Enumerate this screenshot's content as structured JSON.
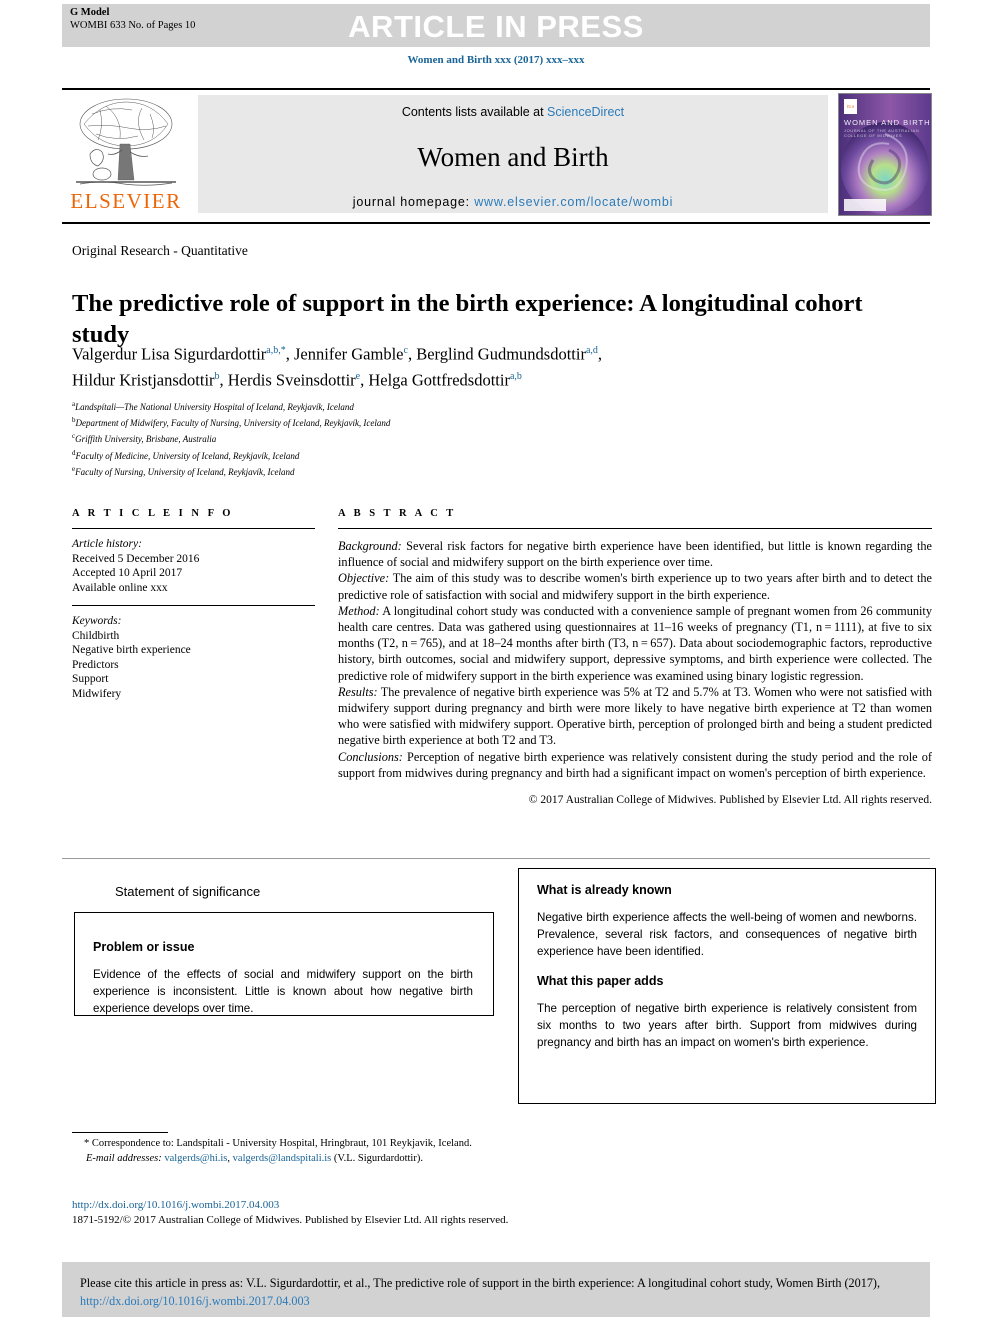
{
  "header": {
    "g_model_label": "G Model",
    "g_model_id": "WOMBI 633 No. of Pages 10",
    "article_in_press": "ARTICLE IN PRESS",
    "journal_citation": "Women and Birth xxx (2017) xxx–xxx"
  },
  "masthead": {
    "publisher": "ELSEVIER",
    "contents_prefix": "Contents lists available at ",
    "contents_link": "ScienceDirect",
    "journal_name": "Women and Birth",
    "homepage_prefix": "journal homepage: ",
    "homepage_link": "www.elsevier.com/locate/wombi",
    "cover_title": "WOMEN AND BIRTH",
    "cover_subtitle": "JOURNAL OF THE AUSTRALIAN COLLEGE OF MIDWIVES",
    "cover_logo_text": "ELS"
  },
  "article": {
    "section": "Original Research - Quantitative",
    "title": "The predictive role of support in the birth experience: A longitudinal cohort study",
    "authors_line1_a": "Valgerdur Lisa Sigurdardottir",
    "authors_line1_a_sup": "a,b,*",
    "authors_line1_b": ", Jennifer Gamble",
    "authors_line1_b_sup": "c",
    "authors_line1_c": ", Berglind Gudmundsdottir",
    "authors_line1_c_sup": "a,d",
    "authors_line1_end": ",",
    "authors_line2_a": "Hildur Kristjansdottir",
    "authors_line2_a_sup": "b",
    "authors_line2_b": ", Herdis Sveinsdottir",
    "authors_line2_b_sup": "e",
    "authors_line2_c": ", Helga Gottfredsdottir",
    "authors_line2_c_sup": "a,b",
    "affiliations": [
      {
        "mark": "a",
        "text": "Landspítali—The National University Hospital of Iceland, Reykjavík, Iceland"
      },
      {
        "mark": "b",
        "text": "Department of Midwifery, Faculty of Nursing, University of Iceland, Reykjavík, Iceland"
      },
      {
        "mark": "c",
        "text": "Griffith University, Brisbane, Australia"
      },
      {
        "mark": "d",
        "text": "Faculty of Medicine, University of Iceland, Reykjavík, Iceland"
      },
      {
        "mark": "e",
        "text": "Faculty of Nursing, University of Iceland, Reykjavík, Iceland"
      }
    ]
  },
  "article_info": {
    "heading": "A R T I C L E  I N F O",
    "history_label": "Article history:",
    "received": "Received 5 December 2016",
    "accepted": "Accepted 10 April 2017",
    "available": "Available online xxx",
    "keywords_label": "Keywords:",
    "keywords": [
      "Childbirth",
      "Negative birth experience",
      "Predictors",
      "Support",
      "Midwifery"
    ]
  },
  "abstract": {
    "heading": "A B S T R A C T",
    "background_label": "Background:",
    "background_text": " Several risk factors for negative birth experience have been identified, but little is known regarding the influence of social and midwifery support on the birth experience over time.",
    "objective_label": "Objective:",
    "objective_text": " The aim of this study was to describe women's birth experience up to two years after birth and to detect the predictive role of satisfaction with social and midwifery support in the birth experience.",
    "method_label": "Method:",
    "method_text": " A longitudinal cohort study was conducted with a convenience sample of pregnant women from 26 community health care centres. Data was gathered using questionnaires at 11–16 weeks of pregnancy (T1, n = 1111), at five to six months (T2, n = 765), and at 18–24 months after birth (T3, n = 657). Data about sociodemographic factors, reproductive history, birth outcomes, social and midwifery support, depressive symptoms, and birth experience were collected. The predictive role of midwifery support in the birth experience was examined using binary logistic regression.",
    "results_label": "Results:",
    "results_text": " The prevalence of negative birth experience was 5% at T2 and 5.7% at T3. Women who were not satisfied with midwifery support during pregnancy and birth were more likely to have negative birth experience at T2 than women who were satisfied with midwifery support. Operative birth, perception of prolonged birth and being a student predicted negative birth experience at both T2 and T3.",
    "conclusions_label": "Conclusions:",
    "conclusions_text": " Perception of negative birth experience was relatively consistent during the study period and the role of support from midwives during pregnancy and birth had a significant impact on women's perception of birth experience.",
    "copyright": "© 2017 Australian College of Midwives. Published by Elsevier Ltd. All rights reserved."
  },
  "significance": {
    "title": "Statement of significance",
    "problem_heading": "Problem or issue",
    "problem_text": "Evidence of the effects of social and midwifery support on the birth experience is inconsistent. Little is known about how negative birth experience develops over time.",
    "known_heading": "What is already known",
    "known_text": "Negative birth experience affects the well-being of women and newborns. Prevalence, several risk factors, and consequences of negative birth experience have been identified.",
    "adds_heading": "What this paper adds",
    "adds_text": "The perception of negative birth experience is relatively consistent from six months to two years after birth. Support from midwives during pregnancy and birth has an impact on women's birth experience."
  },
  "footnotes": {
    "correspondence_mark": "*",
    "correspondence_text": " Correspondence to: Landspitali - University Hospital, Hringbraut, 101 Reykjavik, Iceland.",
    "email_label": "E-mail addresses:",
    "email_1": "valgerds@hi.is",
    "email_sep": ", ",
    "email_2": "valgerds@landspitali.is",
    "email_suffix": " (V.L. Sigurdardottir).",
    "doi_link": "http://dx.doi.org/10.1016/j.wombi.2017.04.003",
    "issn_line": "1871-5192/© 2017 Australian College of Midwives. Published by Elsevier Ltd. All rights reserved."
  },
  "citation": {
    "text_prefix": "Please cite this article in press as: V.L. Sigurdardottir, et al., The predictive role of support in the birth experience: A longitudinal cohort study, Women Birth (2017), ",
    "link": "http://dx.doi.org/10.1016/j.wombi.2017.04.003"
  },
  "colors": {
    "link_blue": "#2b7bba",
    "journal_blue": "#1a6496",
    "elsevier_orange": "#eb6608",
    "banner_gray": "#d2d2d2",
    "contents_gray": "#e8e8e8"
  }
}
